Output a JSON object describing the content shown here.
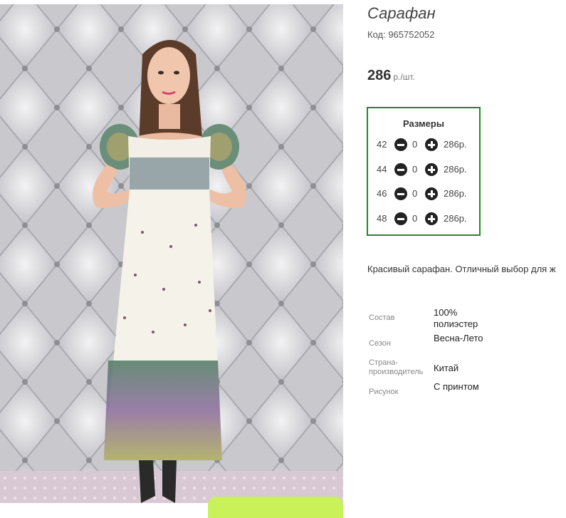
{
  "product": {
    "title": "Сарафан",
    "code": "Код: 965752052",
    "price_value": "286",
    "price_unit": "р./шт."
  },
  "sizes": {
    "title": "Размеры",
    "rows": [
      {
        "size": "42",
        "qty": "0",
        "price": "286р."
      },
      {
        "size": "44",
        "qty": "0",
        "price": "286р."
      },
      {
        "size": "46",
        "qty": "0",
        "price": "286р."
      },
      {
        "size": "48",
        "qty": "0",
        "price": "286р."
      }
    ]
  },
  "description": "Красивый сарафан. Отличный выбор для ж",
  "attributes": [
    {
      "label": "Состав",
      "value": "100% полиэстер"
    },
    {
      "label": "Сезон",
      "value": "Весна-Лето"
    },
    {
      "label": "Страна-производитель",
      "value": "Китай"
    },
    {
      "label": "Рисунок",
      "value": "С принтом"
    }
  ],
  "icons": {
    "minus": "minus-circle-icon",
    "plus": "plus-circle-icon"
  },
  "colors": {
    "sizes_border": "#1f8a1f",
    "button_green": "#c9f15a"
  }
}
